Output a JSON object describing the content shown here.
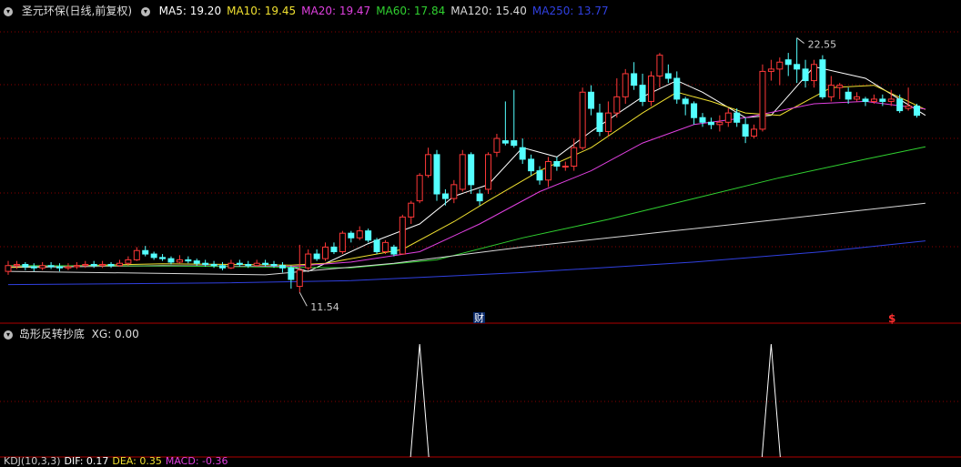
{
  "legend": {
    "stock_name": "圣元环保(日线,前复权)",
    "ma": [
      {
        "label": "MA5: 19.20",
        "color": "#ffffff"
      },
      {
        "label": "MA10: 19.45",
        "color": "#f0e030"
      },
      {
        "label": "MA20: 19.47",
        "color": "#e040e0"
      },
      {
        "label": "MA60: 17.84",
        "color": "#30d030"
      },
      {
        "label": "MA120: 15.40",
        "color": "#d8d8d8"
      },
      {
        "label": "MA250: 13.77",
        "color": "#3040e0"
      }
    ]
  },
  "sub_legend": {
    "title": "岛形反转抄底",
    "value": "XG: 0.00"
  },
  "bottom_legend": [
    {
      "label": "KDJ(10,3,3)",
      "color": "#cccccc"
    },
    {
      "label": "DIF: 0.17",
      "color": "#ffffff"
    },
    {
      "label": "DEA: 0.35",
      "color": "#f0e030"
    },
    {
      "label": "MACD: -0.36",
      "color": "#e040e0"
    }
  ],
  "annotations": {
    "high_label": "22.55",
    "low_label": "11.54",
    "marker_cai": "财",
    "marker_dollar": "$"
  },
  "colors": {
    "up": "#ff3838",
    "down": "#54ffff",
    "grid": "#8a0000",
    "divider": "#b00000"
  },
  "chart_data": {
    "type": "candlestick",
    "price_range": [
      10.8,
      23.4
    ],
    "candles": [
      [
        12.45,
        12.7,
        12.9,
        12.3
      ],
      [
        12.7,
        12.75,
        12.9,
        12.55
      ],
      [
        12.75,
        12.65,
        12.85,
        12.5
      ],
      [
        12.65,
        12.6,
        12.8,
        12.45
      ],
      [
        12.6,
        12.7,
        12.85,
        12.5
      ],
      [
        12.7,
        12.65,
        12.85,
        12.55
      ],
      [
        12.65,
        12.6,
        12.8,
        12.45
      ],
      [
        12.6,
        12.65,
        12.8,
        12.5
      ],
      [
        12.65,
        12.7,
        12.85,
        12.55
      ],
      [
        12.7,
        12.75,
        12.9,
        12.6
      ],
      [
        12.75,
        12.7,
        12.9,
        12.6
      ],
      [
        12.7,
        12.75,
        12.9,
        12.6
      ],
      [
        12.75,
        12.7,
        12.85,
        12.6
      ],
      [
        12.7,
        12.8,
        12.95,
        12.65
      ],
      [
        12.8,
        12.95,
        13.1,
        12.7
      ],
      [
        12.95,
        13.35,
        13.5,
        12.9
      ],
      [
        13.35,
        13.2,
        13.55,
        13.1
      ],
      [
        13.2,
        13.05,
        13.3,
        12.95
      ],
      [
        13.05,
        13.0,
        13.2,
        12.9
      ],
      [
        13.0,
        12.85,
        13.1,
        12.75
      ],
      [
        12.85,
        12.95,
        13.15,
        12.8
      ],
      [
        12.95,
        12.9,
        13.1,
        12.8
      ],
      [
        12.9,
        12.8,
        13.0,
        12.7
      ],
      [
        12.8,
        12.75,
        12.95,
        12.65
      ],
      [
        12.75,
        12.7,
        12.9,
        12.6
      ],
      [
        12.7,
        12.6,
        12.85,
        12.5
      ],
      [
        12.6,
        12.8,
        12.95,
        12.55
      ],
      [
        12.8,
        12.75,
        12.95,
        12.65
      ],
      [
        12.75,
        12.7,
        12.9,
        12.6
      ],
      [
        12.7,
        12.8,
        12.95,
        12.65
      ],
      [
        12.8,
        12.75,
        12.95,
        12.65
      ],
      [
        12.75,
        12.7,
        12.9,
        12.6
      ],
      [
        12.7,
        12.6,
        12.85,
        12.4
      ],
      [
        12.6,
        12.1,
        12.7,
        11.7
      ],
      [
        11.8,
        12.5,
        13.6,
        11.54
      ],
      [
        12.6,
        13.2,
        13.4,
        12.5
      ],
      [
        13.2,
        13.0,
        13.4,
        12.9
      ],
      [
        13.0,
        13.5,
        13.7,
        12.9
      ],
      [
        13.5,
        13.3,
        13.7,
        13.2
      ],
      [
        13.3,
        14.1,
        14.2,
        13.2
      ],
      [
        14.1,
        13.9,
        14.2,
        13.7
      ],
      [
        13.9,
        14.2,
        14.4,
        13.8
      ],
      [
        14.2,
        13.8,
        14.3,
        13.7
      ],
      [
        13.8,
        13.3,
        13.9,
        13.2
      ],
      [
        13.3,
        13.7,
        13.8,
        13.2
      ],
      [
        13.5,
        13.2,
        13.6,
        13.1
      ],
      [
        13.2,
        14.8,
        14.9,
        13.2
      ],
      [
        14.8,
        15.4,
        15.5,
        14.5
      ],
      [
        15.5,
        16.6,
        16.7,
        15.4
      ],
      [
        16.6,
        17.5,
        17.8,
        16.5
      ],
      [
        17.5,
        15.8,
        17.7,
        15.5
      ],
      [
        15.8,
        15.6,
        16.0,
        15.3
      ],
      [
        15.6,
        16.2,
        16.4,
        15.4
      ],
      [
        16.0,
        17.5,
        17.7,
        15.9
      ],
      [
        17.5,
        16.2,
        17.6,
        15.8
      ],
      [
        15.8,
        15.5,
        16.0,
        15.3
      ],
      [
        16.0,
        17.5,
        17.6,
        15.8
      ],
      [
        17.6,
        18.2,
        18.4,
        17.4
      ],
      [
        18.1,
        18.0,
        19.8,
        17.9
      ],
      [
        18.1,
        17.9,
        20.3,
        17.8
      ],
      [
        17.8,
        17.3,
        18.2,
        17.1
      ],
      [
        17.3,
        16.8,
        17.5,
        16.6
      ],
      [
        16.8,
        16.4,
        17.0,
        16.2
      ],
      [
        16.4,
        17.2,
        17.4,
        16.1
      ],
      [
        17.2,
        17.0,
        17.4,
        16.8
      ],
      [
        17.0,
        17.0,
        17.2,
        16.8
      ],
      [
        17.0,
        17.8,
        18.2,
        16.8
      ],
      [
        17.8,
        20.2,
        20.4,
        17.7
      ],
      [
        20.2,
        19.5,
        20.5,
        19.2
      ],
      [
        19.3,
        18.5,
        19.7,
        18.3
      ],
      [
        18.5,
        19.3,
        19.8,
        18.3
      ],
      [
        19.3,
        20.0,
        20.8,
        19.1
      ],
      [
        20.0,
        21.0,
        21.2,
        19.7
      ],
      [
        21.0,
        20.5,
        21.5,
        20.3
      ],
      [
        20.5,
        19.8,
        21.0,
        19.6
      ],
      [
        19.8,
        20.9,
        21.1,
        19.6
      ],
      [
        20.9,
        21.8,
        21.9,
        20.4
      ],
      [
        21.0,
        20.8,
        21.4,
        20.6
      ],
      [
        20.8,
        19.9,
        21.1,
        19.7
      ],
      [
        19.9,
        19.7,
        20.0,
        19.2
      ],
      [
        19.7,
        19.1,
        19.8,
        18.8
      ],
      [
        19.1,
        18.9,
        19.3,
        18.7
      ],
      [
        18.9,
        18.8,
        19.1,
        18.6
      ],
      [
        18.8,
        18.9,
        19.2,
        18.5
      ],
      [
        18.9,
        19.3,
        19.5,
        18.7
      ],
      [
        19.3,
        18.9,
        19.5,
        18.7
      ],
      [
        18.8,
        18.3,
        19.1,
        18.0
      ],
      [
        18.3,
        18.6,
        18.8,
        18.2
      ],
      [
        18.6,
        21.1,
        21.4,
        18.5
      ],
      [
        21.1,
        21.2,
        21.6,
        20.7
      ],
      [
        21.2,
        21.5,
        21.7,
        20.5
      ],
      [
        21.6,
        21.4,
        21.9,
        20.9
      ],
      [
        21.4,
        21.2,
        22.55,
        20.6
      ],
      [
        21.2,
        20.7,
        21.6,
        20.4
      ],
      [
        20.7,
        21.4,
        21.6,
        20.4
      ],
      [
        21.6,
        20.0,
        21.8,
        19.9
      ],
      [
        20.0,
        20.5,
        20.9,
        19.8
      ],
      [
        20.4,
        20.5,
        20.6,
        19.9
      ],
      [
        20.2,
        19.9,
        20.4,
        19.7
      ],
      [
        19.9,
        20.0,
        20.2,
        19.8
      ],
      [
        19.9,
        19.8,
        20.0,
        19.6
      ],
      [
        19.8,
        19.9,
        20.1,
        19.7
      ],
      [
        19.9,
        19.8,
        20.1,
        19.6
      ],
      [
        19.8,
        19.9,
        20.3,
        19.6
      ],
      [
        19.9,
        19.4,
        20.1,
        19.3
      ],
      [
        19.5,
        19.6,
        20.4,
        19.4
      ],
      [
        19.6,
        19.2,
        19.7,
        19.1
      ]
    ],
    "ma_lines": [
      {
        "name": "MA5",
        "color": "#ffffff",
        "values": [
          [
            0,
            12.62
          ],
          [
            18,
            12.7
          ],
          [
            33,
            12.65
          ],
          [
            35,
            12.45
          ],
          [
            42,
            13.65
          ],
          [
            48,
            14.5
          ],
          [
            52,
            15.7
          ],
          [
            56,
            16.2
          ],
          [
            60,
            17.8
          ],
          [
            64,
            17.4
          ],
          [
            68,
            18.5
          ],
          [
            74,
            20.0
          ],
          [
            78,
            20.7
          ],
          [
            81,
            20.2
          ],
          [
            86,
            19.1
          ],
          [
            89,
            19.2
          ],
          [
            94,
            21.3
          ],
          [
            100,
            20.8
          ],
          [
            107,
            19.2
          ]
        ]
      },
      {
        "name": "MA10",
        "color": "#f0e030",
        "values": [
          [
            0,
            12.63
          ],
          [
            18,
            12.78
          ],
          [
            33,
            12.72
          ],
          [
            37,
            12.8
          ],
          [
            46,
            13.4
          ],
          [
            52,
            14.6
          ],
          [
            56,
            15.5
          ],
          [
            62,
            16.8
          ],
          [
            68,
            17.8
          ],
          [
            74,
            19.3
          ],
          [
            78,
            20.2
          ],
          [
            82,
            19.8
          ],
          [
            86,
            19.3
          ],
          [
            90,
            19.2
          ],
          [
            96,
            20.4
          ],
          [
            101,
            20.5
          ],
          [
            107,
            19.45
          ]
        ]
      },
      {
        "name": "MA20",
        "color": "#e040e0",
        "values": [
          [
            0,
            12.68
          ],
          [
            20,
            12.68
          ],
          [
            33,
            12.66
          ],
          [
            40,
            12.85
          ],
          [
            48,
            13.3
          ],
          [
            55,
            14.5
          ],
          [
            62,
            15.9
          ],
          [
            68,
            16.8
          ],
          [
            74,
            18.0
          ],
          [
            80,
            18.8
          ],
          [
            86,
            19.1
          ],
          [
            94,
            19.7
          ],
          [
            100,
            19.8
          ],
          [
            107,
            19.47
          ]
        ]
      },
      {
        "name": "MA60",
        "color": "#30d030",
        "values": [
          [
            0,
            12.7
          ],
          [
            20,
            12.68
          ],
          [
            40,
            12.6
          ],
          [
            50,
            12.95
          ],
          [
            60,
            13.9
          ],
          [
            70,
            14.7
          ],
          [
            80,
            15.6
          ],
          [
            90,
            16.5
          ],
          [
            100,
            17.3
          ],
          [
            107,
            17.84
          ]
        ]
      },
      {
        "name": "MA120",
        "color": "#d8d8d8",
        "values": [
          [
            0,
            12.45
          ],
          [
            30,
            12.3
          ],
          [
            45,
            12.8
          ],
          [
            60,
            13.5
          ],
          [
            75,
            14.1
          ],
          [
            90,
            14.7
          ],
          [
            107,
            15.4
          ]
        ]
      },
      {
        "name": "MA250",
        "color": "#3040e0",
        "values": [
          [
            0,
            11.88
          ],
          [
            25,
            11.95
          ],
          [
            40,
            12.05
          ],
          [
            60,
            12.4
          ],
          [
            80,
            12.85
          ],
          [
            95,
            13.3
          ],
          [
            107,
            13.77
          ]
        ]
      }
    ],
    "indicator": {
      "name": "XG",
      "spike_centers": [
        48,
        89
      ],
      "range": [
        0,
        1
      ]
    }
  }
}
